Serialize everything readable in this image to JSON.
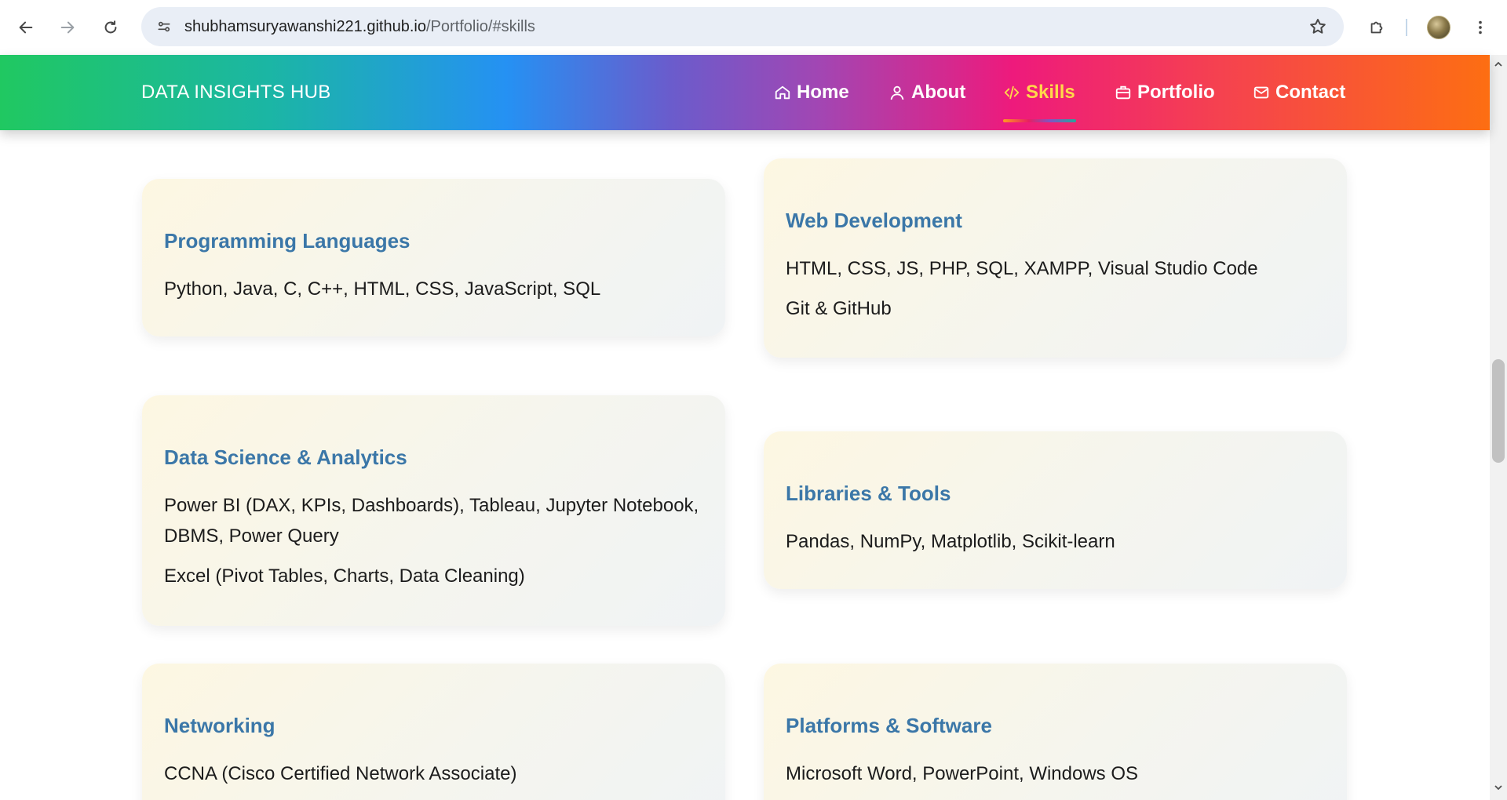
{
  "browser": {
    "url_domain": "shubhamsuryawanshi221.github.io",
    "url_path": "/Portfolio/#skills",
    "icons": [
      "back-arrow-icon",
      "forward-arrow-icon",
      "reload-icon",
      "site-info-icon",
      "bookmark-star-icon",
      "extensions-puzzle-icon",
      "profile-avatar",
      "kebab-menu-icon"
    ]
  },
  "navbar": {
    "brand": "DATA INSIGHTS HUB",
    "items": [
      {
        "label": "Home",
        "icon": "home-icon"
      },
      {
        "label": "About",
        "icon": "user-icon"
      },
      {
        "label": "Skills",
        "icon": "code-icon",
        "active": true
      },
      {
        "label": "Portfolio",
        "icon": "briefcase-icon"
      },
      {
        "label": "Contact",
        "icon": "mail-icon"
      }
    ],
    "active_color": "#ffd84a"
  },
  "skills": [
    {
      "title": "Programming Languages",
      "lines": [
        "Python, Java, C, C++, HTML, CSS, JavaScript, SQL"
      ]
    },
    {
      "title": "Web Development",
      "lines": [
        "HTML, CSS, JS, PHP, SQL, XAMPP, Visual Studio Code",
        "Git & GitHub"
      ]
    },
    {
      "title": "Data Science & Analytics",
      "lines": [
        "Power BI (DAX, KPIs, Dashboards), Tableau, Jupyter Notebook, DBMS, Power Query",
        "Excel (Pivot Tables, Charts, Data Cleaning)"
      ]
    },
    {
      "title": "Libraries & Tools",
      "lines": [
        "Pandas, NumPy, Matplotlib, Scikit-learn"
      ]
    },
    {
      "title": "Networking",
      "lines": [
        "CCNA (Cisco Certified Network Associate)"
      ]
    },
    {
      "title": "Platforms & Software",
      "lines": [
        "Microsoft Word, PowerPoint, Windows OS"
      ]
    }
  ],
  "colors": {
    "card_title": "#3b77a8",
    "omnibox": "#e9eef6"
  }
}
